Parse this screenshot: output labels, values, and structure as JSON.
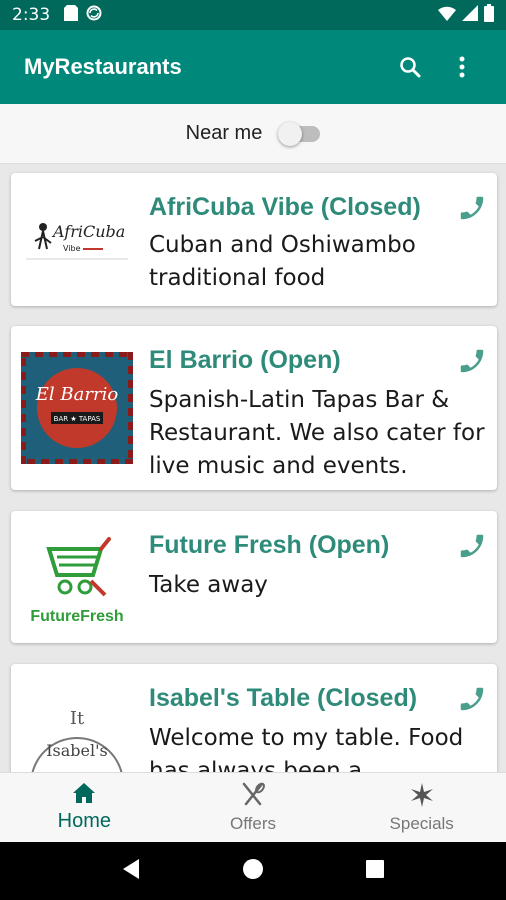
{
  "status_bar": {
    "time": "2:33"
  },
  "app_bar": {
    "title": "MyRestaurants",
    "search_icon": "search-icon",
    "more_icon": "more-vert-icon"
  },
  "filter": {
    "label": "Near me",
    "toggle_on": false
  },
  "restaurants": [
    {
      "name": "AfriCuba Vibe (Closed)",
      "description": "Cuban and Oshiwambo traditional food",
      "logo_text": "AfriCuba"
    },
    {
      "name": "El Barrio (Open)",
      "description": "Spanish-Latin Tapas Bar & Restaurant. We also cater for live music and events.",
      "logo_text": "El Barrio",
      "logo_subtext": "BAR ★ TAPAS"
    },
    {
      "name": "Future Fresh (Open)",
      "description": "Take away",
      "logo_text": "FutureFresh"
    },
    {
      "name": "Isabel's Table (Closed)",
      "description": "Welcome to my table. Food has always been a",
      "logo_text": "Isabel's"
    }
  ],
  "bottom_nav": [
    {
      "label": "Home",
      "icon": "home-icon",
      "active": true
    },
    {
      "label": "Offers",
      "icon": "restaurant-icon",
      "active": false
    },
    {
      "label": "Specials",
      "icon": "sparkle-icon",
      "active": false
    }
  ],
  "colors": {
    "primary": "#00897b",
    "primary_dark": "#00695c",
    "accent_text": "#2e8b7a"
  }
}
